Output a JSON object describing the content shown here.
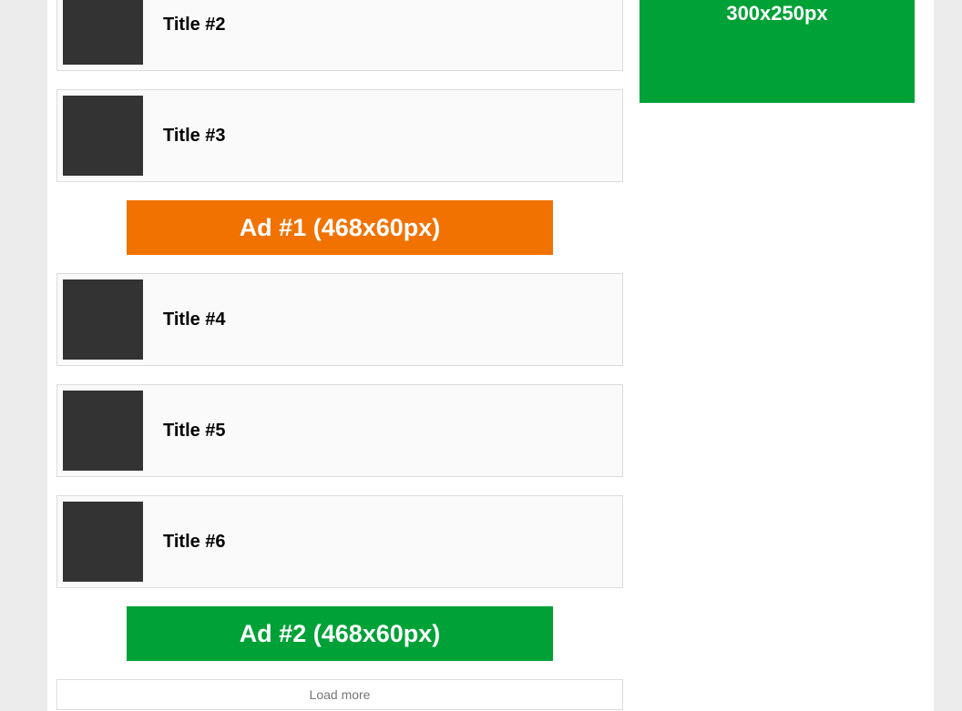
{
  "posts_group1": [
    {
      "title": "Title #2"
    },
    {
      "title": "Title #3"
    }
  ],
  "posts_group2": [
    {
      "title": "Title #4"
    },
    {
      "title": "Title #5"
    },
    {
      "title": "Title #6"
    }
  ],
  "ads": {
    "ad1": {
      "label": "Ad #1 (468x60px)"
    },
    "ad2": {
      "label": "Ad #2 (468x60px)"
    }
  },
  "sidebar": {
    "ad_label": "300x250px"
  },
  "load_more": "Load more"
}
